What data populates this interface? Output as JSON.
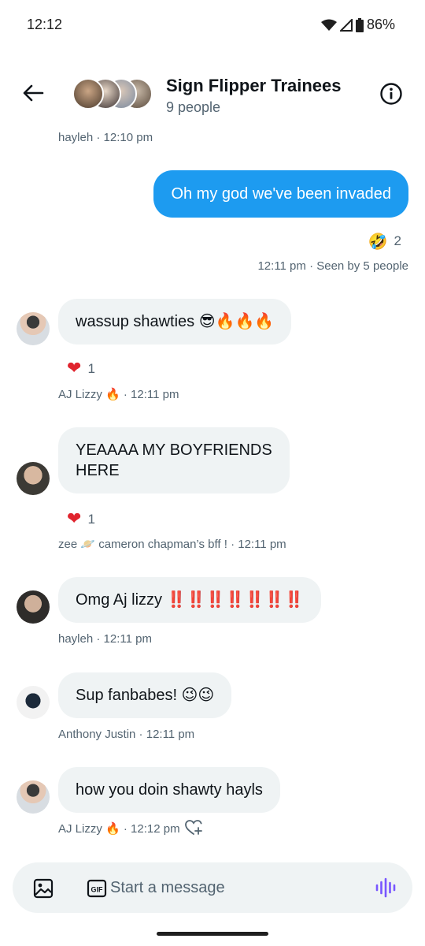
{
  "status_bar": {
    "time": "12:12",
    "battery": "86%"
  },
  "header": {
    "title": "Sign Flipper Trainees",
    "subtitle": "9 people"
  },
  "messages": [
    {
      "meta": "hayleh · 12:10 pm"
    },
    {
      "text": "Oh my god we've been invaded",
      "reaction_emoji": "🤣",
      "reaction_count": "2",
      "meta": "12:11 pm · Seen by 5 people"
    },
    {
      "text": "wassup shawties 😎🔥🔥🔥",
      "reaction_emoji": "❤️",
      "reaction_count": "1",
      "meta": "AJ Lizzy 🔥 · 12:11 pm"
    },
    {
      "text": "YEAAAA MY BOYFRIENDS HERE",
      "reaction_emoji": "❤️",
      "reaction_count": "1",
      "meta": "zee 🪐 cameron chapman’s bff ! · 12:11 pm"
    },
    {
      "text": "Omg Aj lizzy ‼️‼️‼️‼️‼️‼️‼️",
      "meta": "hayleh · 12:11 pm"
    },
    {
      "text": "Sup fanbabes! 😉😉",
      "meta": "Anthony Justin · 12:11 pm"
    },
    {
      "text": "how you doin shawty hayls",
      "meta": "AJ Lizzy 🔥 · 12:12 pm"
    }
  ],
  "composer": {
    "placeholder": "Start a message"
  },
  "colors": {
    "accent": "#1d9bf0",
    "bubble_in": "#eff3f4",
    "muted": "#536471",
    "voice": "#7856ff"
  }
}
